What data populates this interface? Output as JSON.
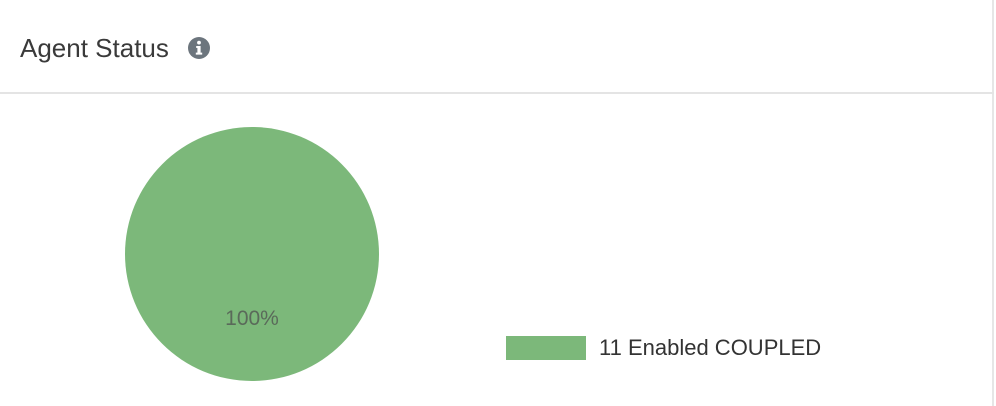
{
  "panel": {
    "title": "Agent Status",
    "info_icon": "info-circle-icon"
  },
  "colors": {
    "slice": "#7cb87a",
    "info_icon": "#6c757d",
    "label": "#5a6a5a"
  },
  "chart_data": {
    "type": "pie",
    "title": "",
    "categories": [
      "11 Enabled COUPLED"
    ],
    "values": [
      11
    ],
    "slice_labels": [
      "100%"
    ],
    "legend": {
      "placement": "right",
      "entries": [
        "11 Enabled COUPLED"
      ]
    }
  }
}
